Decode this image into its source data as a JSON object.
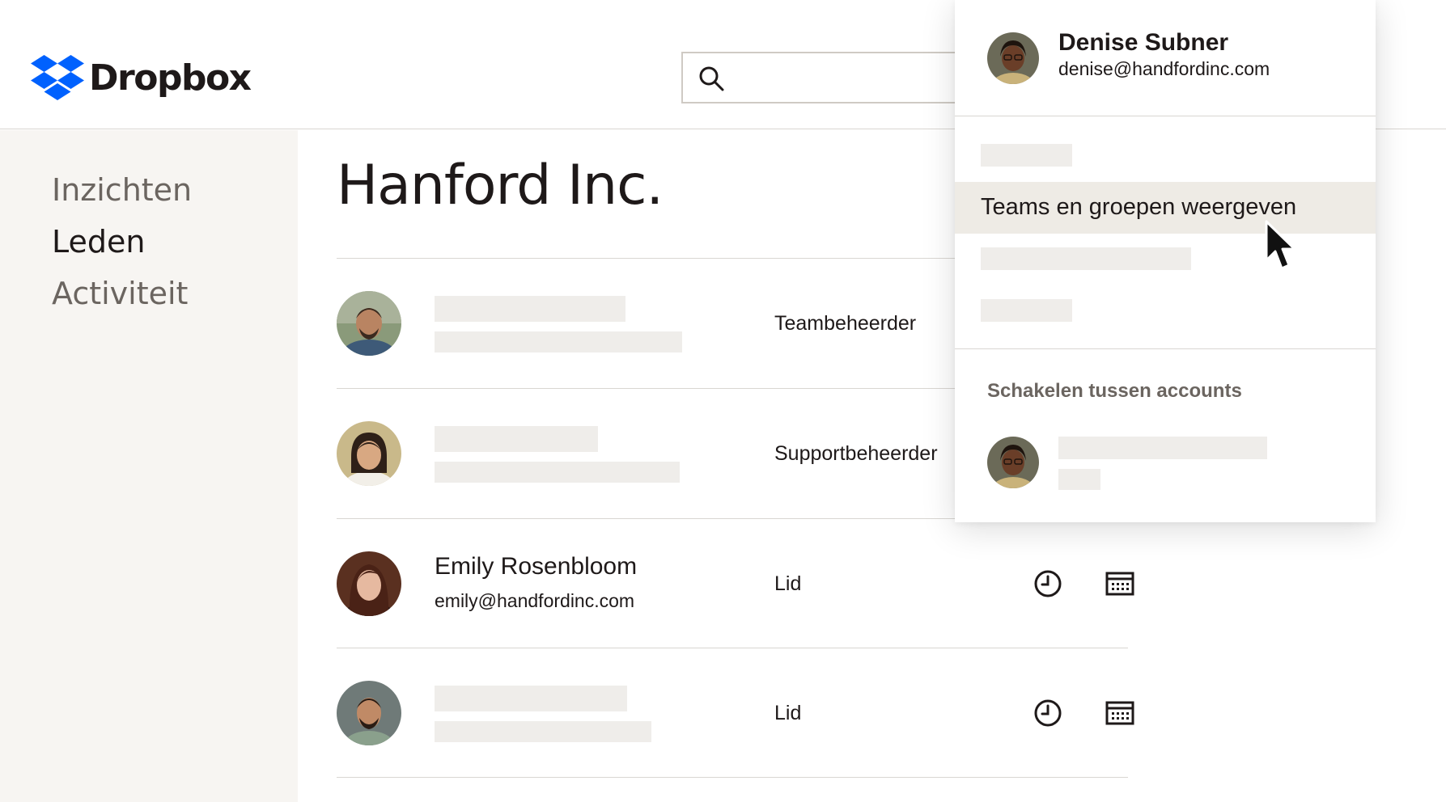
{
  "header": {
    "brand": "Dropbox",
    "search": {
      "placeholder": "",
      "value": ""
    }
  },
  "sidebar": {
    "items": [
      {
        "label": "Inzichten",
        "active": false
      },
      {
        "label": "Leden",
        "active": true
      },
      {
        "label": "Activiteit",
        "active": false
      }
    ]
  },
  "main": {
    "title": "Hanford Inc.",
    "members": [
      {
        "name": "",
        "email": "",
        "role": "Teambeheerder"
      },
      {
        "name": "",
        "email": "",
        "role": "Supportbeheerder"
      },
      {
        "name": "Emily Rosenbloom",
        "email": "emily@handfordinc.com",
        "role": "Lid",
        "icons": [
          "clock-icon",
          "calendar-icon"
        ]
      },
      {
        "name": "",
        "email": "",
        "role": "Lid",
        "icons": [
          "clock-icon",
          "calendar-icon"
        ]
      }
    ]
  },
  "account_menu": {
    "user": {
      "name": "Denise Subner",
      "email": "denise@handfordinc.com"
    },
    "highlighted_item": "Teams en groepen weergeven",
    "switch_section_title": "Schakelen tussen accounts"
  },
  "colors": {
    "brand_blue": "#0061fe",
    "sidebar_bg": "#f7f5f2",
    "placeholder": "#efedea",
    "highlight": "#eeebe5",
    "text": "#1e1919",
    "muted": "#6b6560"
  }
}
